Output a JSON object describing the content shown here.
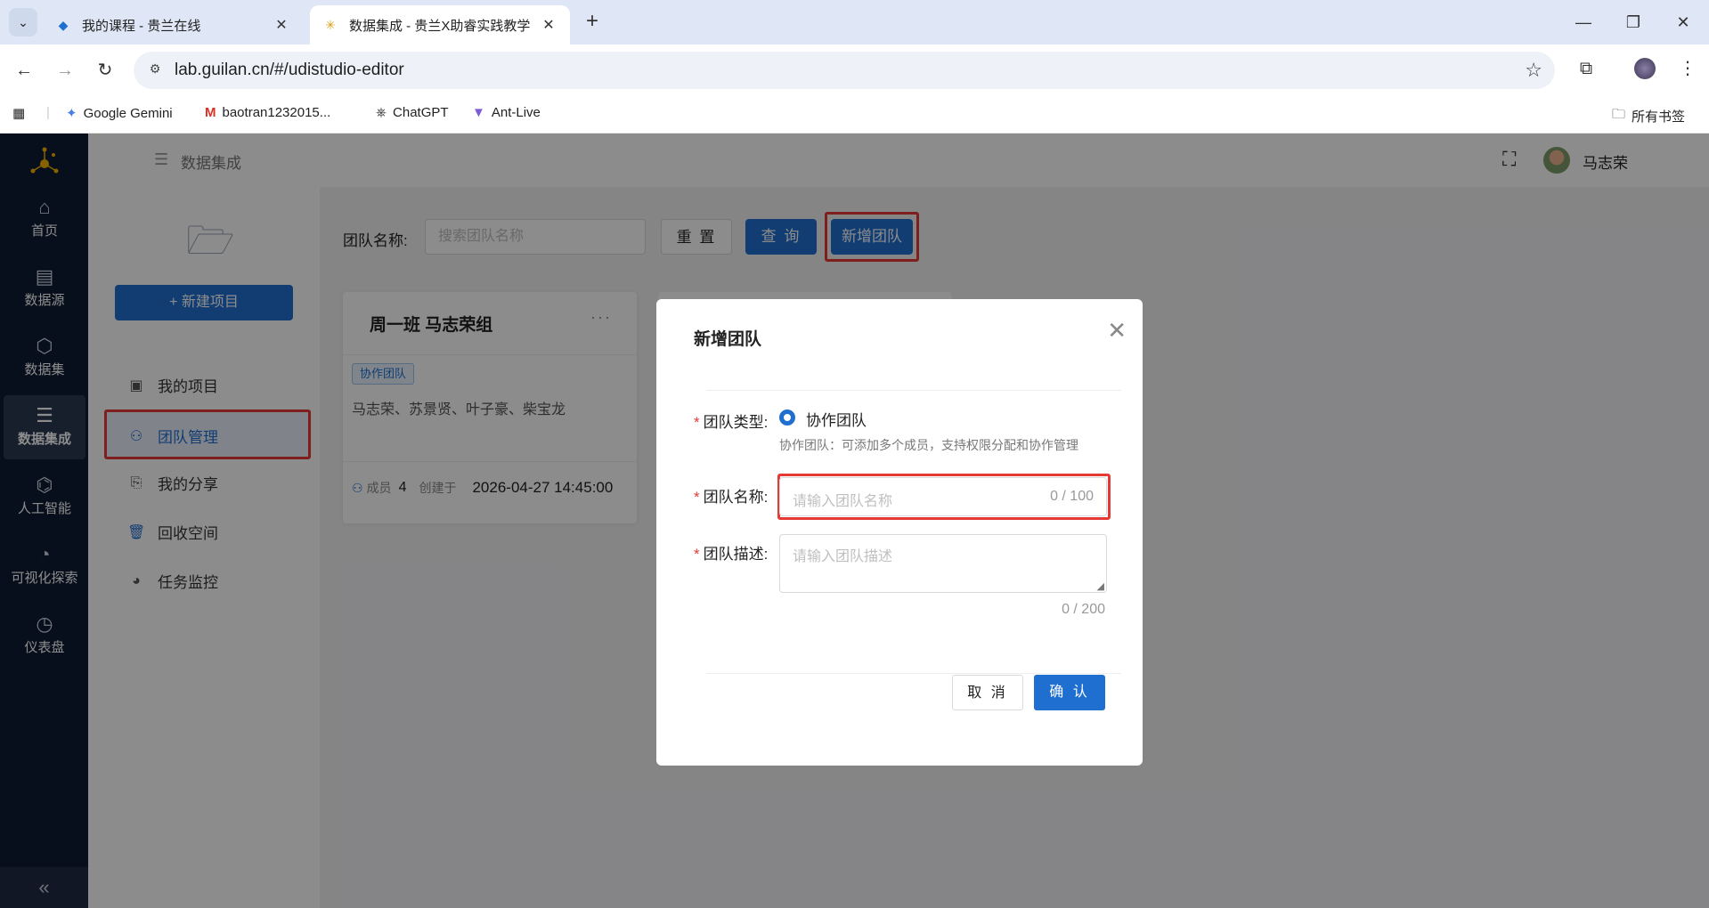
{
  "browser": {
    "tabs": [
      {
        "title": "我的课程 - 贵兰在线",
        "active": false
      },
      {
        "title": "数据集成 - 贵兰X助睿实践教学",
        "active": true
      }
    ],
    "url": "lab.guilan.cn/#/udistudio-editor",
    "bookmarks": [
      {
        "label": "Google Gemini",
        "icon": "gemini-icon"
      },
      {
        "label": "baotran1232015...",
        "icon": "gmail-icon"
      },
      {
        "label": "ChatGPT",
        "icon": "chatgpt-icon"
      },
      {
        "label": "Ant-Live",
        "icon": "ant-live-icon"
      }
    ],
    "all_bookmarks": "所有书签"
  },
  "leftnav": {
    "items": [
      {
        "label": "首页",
        "icon": "home-icon"
      },
      {
        "label": "数据源",
        "icon": "datasource-icon"
      },
      {
        "label": "数据集",
        "icon": "dataset-icon"
      },
      {
        "label": "数据集成",
        "icon": "integration-icon",
        "active": true
      },
      {
        "label": "人工智能",
        "icon": "ai-icon"
      },
      {
        "label": "可视化探索",
        "icon": "visualization-icon"
      },
      {
        "label": "仪表盘",
        "icon": "dashboard-icon"
      }
    ],
    "collapse": "«"
  },
  "topbar": {
    "breadcrumb": "数据集成",
    "username": "马志荣"
  },
  "sidepanel": {
    "new_project": "+ 新建项目",
    "items": [
      {
        "label": "我的项目",
        "icon": "project-icon"
      },
      {
        "label": "团队管理",
        "icon": "team-icon",
        "active": true
      },
      {
        "label": "我的分享",
        "icon": "share-icon"
      },
      {
        "label": "回收空间",
        "icon": "trash-icon"
      },
      {
        "label": "任务监控",
        "icon": "monitor-icon"
      }
    ]
  },
  "query": {
    "label": "团队名称:",
    "placeholder": "搜索团队名称",
    "reset": "重 置",
    "search": "查 询",
    "add_team": "新增团队"
  },
  "team_card": {
    "title": "周一班 马志荣组",
    "more": "···",
    "tag": "协作团队",
    "members": "马志荣、苏景贤、叶子豪、柴宝龙",
    "members_label": "成员",
    "member_count": "4",
    "created_label": "创建于",
    "created_at": "2026-04-27 14:45:00"
  },
  "dialog": {
    "title": "新增团队",
    "type_label": "团队类型:",
    "type_option": "协作团队",
    "type_hint": "协作团队：可添加多个成员，支持权限分配和协作管理",
    "name_label": "团队名称:",
    "name_placeholder": "请输入团队名称",
    "name_count": "0 / 100",
    "desc_label": "团队描述:",
    "desc_placeholder": "请输入团队描述",
    "desc_count": "0 / 200",
    "cancel": "取 消",
    "confirm": "确 认"
  },
  "colors": {
    "primary": "#1f6fd1",
    "highlight": "#e53935",
    "nav_bg": "#0e1c33"
  }
}
